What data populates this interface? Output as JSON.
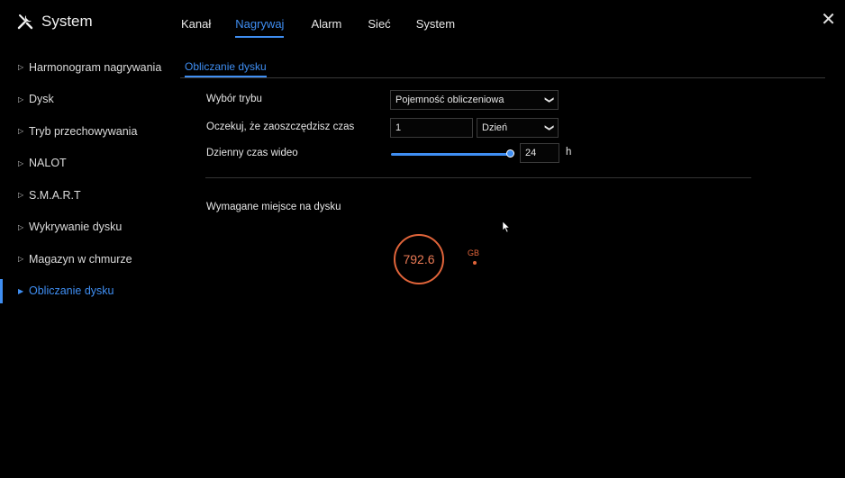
{
  "header": {
    "title": "System",
    "tabs": [
      {
        "label": "Kanał"
      },
      {
        "label": "Nagrywaj"
      },
      {
        "label": "Alarm"
      },
      {
        "label": "Sieć"
      },
      {
        "label": "System"
      }
    ],
    "active_tab": "Nagrywaj"
  },
  "sidebar": {
    "items": [
      {
        "label": "Harmonogram nagrywania"
      },
      {
        "label": "Dysk"
      },
      {
        "label": "Tryb przechowywania"
      },
      {
        "label": "NALOT"
      },
      {
        "label": "S.M.A.R.T"
      },
      {
        "label": "Wykrywanie dysku"
      },
      {
        "label": "Magazyn w chmurze"
      },
      {
        "label": "Obliczanie dysku"
      }
    ],
    "active_item": "Obliczanie dysku"
  },
  "subtab": {
    "label": "Obliczanie dysku"
  },
  "form": {
    "mode_label": "Wybór trybu",
    "mode_value": "Pojemność obliczeniowa",
    "save_time_label": "Oczekuj, że zaoszczędzisz czas",
    "save_time_value": "1",
    "save_time_unit": "Dzień",
    "daily_video_label": "Dzienny czas wideo",
    "daily_video_value": "24",
    "daily_video_unit": "h",
    "daily_video_fraction": 1.0
  },
  "result": {
    "label": "Wymagane miejsce na dysku",
    "value": "792.6",
    "unit": "GB"
  },
  "colors": {
    "accent": "#3f8ef2",
    "gauge": "#e0643a",
    "background": "#000000"
  },
  "icons": {
    "app": "tools-icon",
    "close": "close-icon",
    "dropdown": "chevron-down-icon"
  }
}
